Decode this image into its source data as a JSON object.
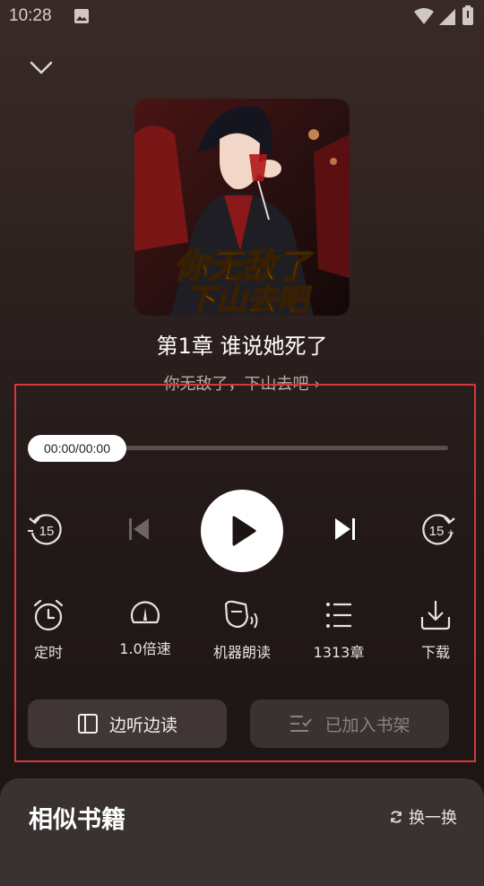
{
  "status_bar": {
    "time": "10:28"
  },
  "book": {
    "cover_text": "你无敌了下山去吧",
    "chapter_title": "第1章 谁说她死了",
    "book_name_link": "你无敌了，下山去吧 ›"
  },
  "player": {
    "time_display": "00:00/00:00",
    "progress": 0,
    "rewind_label": "15",
    "forward_label": "15",
    "forward_plus": "+"
  },
  "functions": [
    {
      "label": "定时",
      "icon": "alarm-clock-icon"
    },
    {
      "label": "1.0倍速",
      "icon": "speedometer-icon"
    },
    {
      "label": "机器朗读",
      "icon": "tts-voice-icon"
    },
    {
      "label": "1313章",
      "icon": "chapter-list-icon"
    },
    {
      "label": "下载",
      "icon": "download-icon"
    }
  ],
  "actions": {
    "listen_read": "边听边读",
    "added_shelf": "已加入书架"
  },
  "similar": {
    "title": "相似书籍",
    "refresh": "换一换"
  },
  "colors": {
    "highlight_frame": "#d23a3a",
    "background": "#2a1f1d"
  }
}
